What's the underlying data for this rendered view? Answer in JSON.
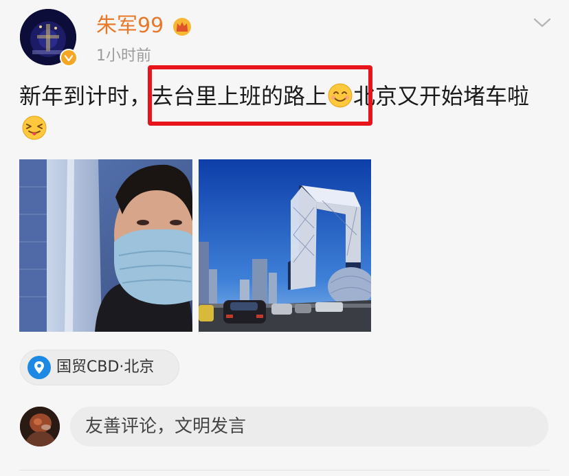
{
  "post": {
    "author": {
      "name": "朱军99",
      "badge_icon": "crown-icon",
      "verified_icon": "verified-badge-icon",
      "verified_color": "#f5a623"
    },
    "timestamp": "1小时前",
    "text_parts": {
      "part1": "新年到计时，",
      "part2": "去台里上班的路上",
      "part3": "北京又开始堵车啦"
    },
    "emojis": [
      "smile-emoji-icon",
      "tongue-wink-emoji-icon"
    ],
    "photos": [
      "selfie-with-mask-photo",
      "cctv-building-traffic-photo"
    ],
    "location": {
      "icon": "location-pin-icon",
      "label": "国贸CBD·北京"
    },
    "menu_icon": "chevron-down-icon"
  },
  "comment_bar": {
    "placeholder": "友善评论，文明发言"
  },
  "colors": {
    "username": "#e8782b",
    "highlight": "#e8141c",
    "location_pin": "#1e88e5",
    "background": "#f6f6f6"
  }
}
